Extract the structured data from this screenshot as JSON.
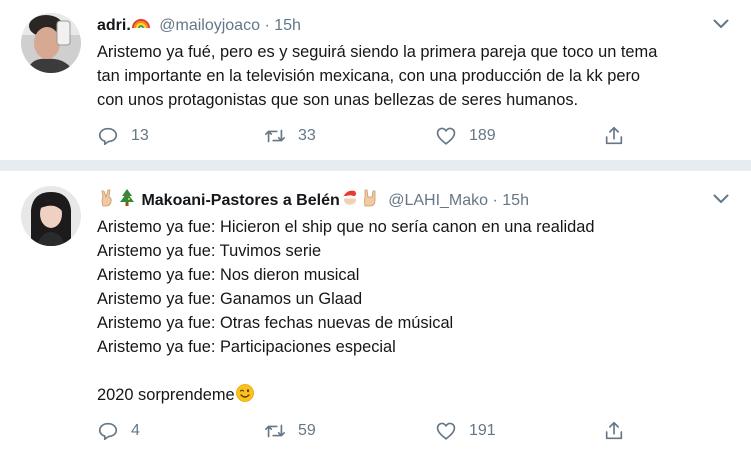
{
  "tweets": [
    {
      "name": "adri.",
      "handle": "@mailoyjoaco",
      "dot": "·",
      "time": "15h",
      "text_lines": [
        "Aristemo ya fué, pero es y seguirá siendo la primera pareja que toco un tema",
        "tan importante en la televisión mexicana, con una producción de la kk pero",
        "con unos protagonistas que son unas bellezas de seres humanos."
      ],
      "name_emojis": [
        "rainbow-emoji"
      ],
      "replies": "13",
      "retweets": "33",
      "likes": "189"
    },
    {
      "name": "Makoani-Pastores a Belén",
      "handle": "@LAHI_Mako",
      "dot": "·",
      "time": "15h",
      "text_lines": [
        "Aristemo ya fue: Hicieron el ship que no sería canon en una realidad",
        "Aristemo ya fue: Tuvimos serie",
        "Aristemo ya fue: Nos dieron musical",
        "Aristemo ya fue: Ganamos un Glaad",
        "Aristemo ya fue: Otras fechas nuevas de músical",
        "Aristemo ya fue: Participaciones especial",
        "",
        "2020 sorprendeme"
      ],
      "name_emojis": [
        "victory-hand-emoji",
        "christmas-tree-emoji",
        "santa-emoji",
        "horns-hand-emoji"
      ],
      "text_emoji": "winking-face-emoji",
      "replies": "4",
      "retweets": "59",
      "likes": "191"
    }
  ],
  "colors": {
    "text": "#14171a",
    "muted": "#657786",
    "divider": "#e6ecf0"
  }
}
